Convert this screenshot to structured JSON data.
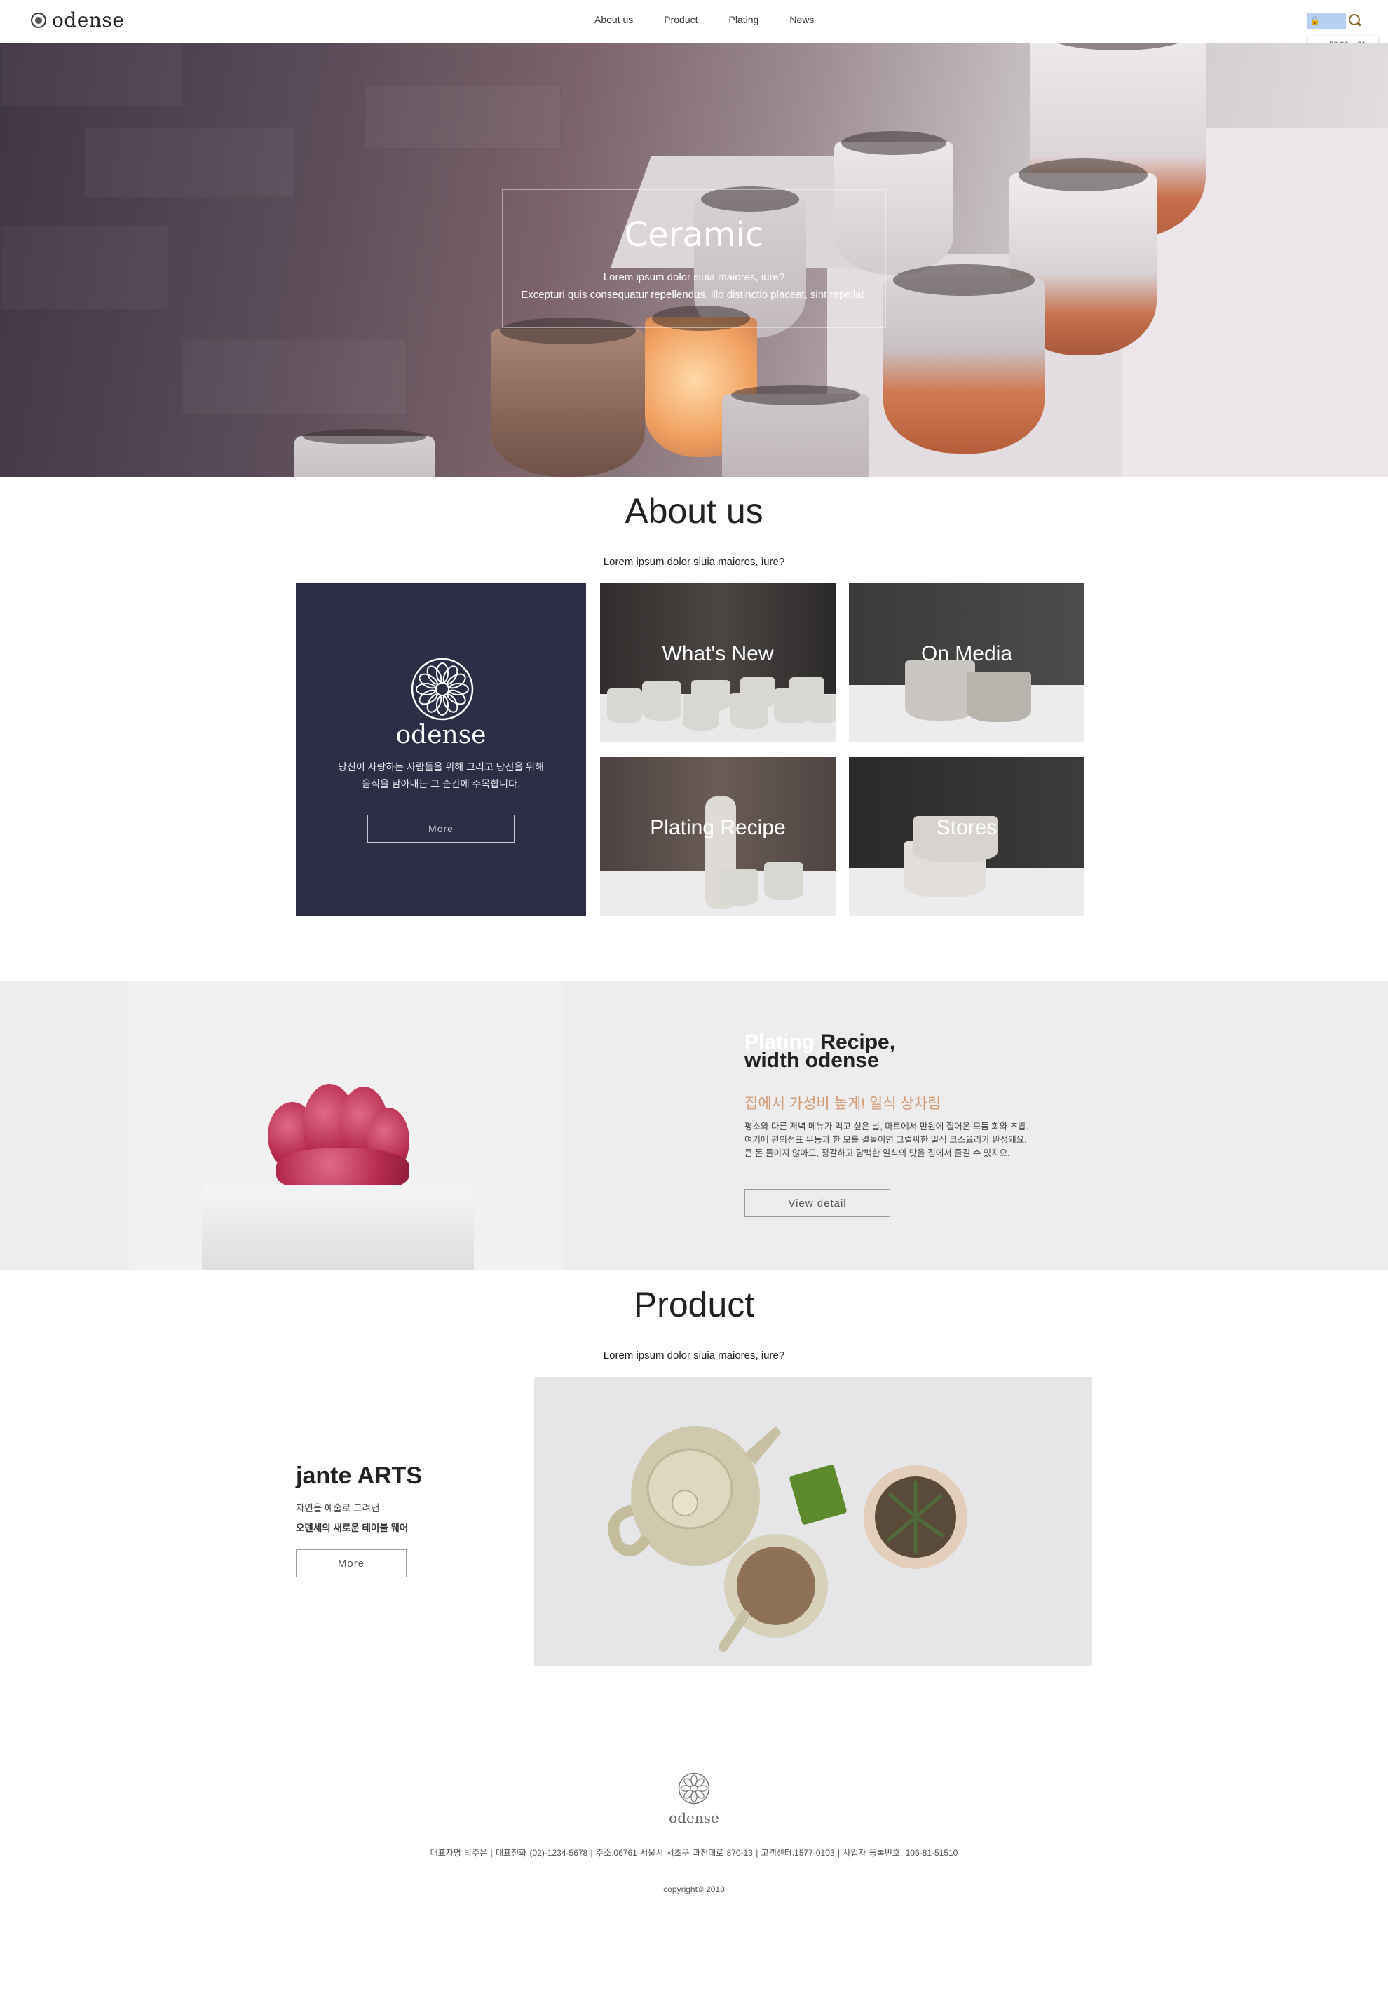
{
  "header": {
    "logo": "odense",
    "nav": [
      "About us",
      "Product",
      "Plating",
      "News"
    ],
    "tooltip_tag": "a",
    "tooltip_size": "52.86 × 21",
    "colors": {
      "search_highlight": "#b7cff0",
      "search_icon": "#8a6a2c"
    }
  },
  "hero": {
    "title": "Ceramic",
    "line1": "Lorem ipsum dolor siuia maiores, iure?",
    "line2": "Excepturi quis consequatur repellendus, illo distinctio placeat, sint repellat."
  },
  "about": {
    "title": "About us",
    "subtitle": "Lorem ipsum dolor siuia maiores, iure?",
    "brand_card": {
      "name": "odense",
      "desc_line1": "당신이 사랑하는 사람들을 위해 그리고 당신을 위해",
      "desc_line2": "음식을 담아내는 그 순간에 주목합니다.",
      "button": "More",
      "color": "#2b2e45"
    },
    "tiles": [
      "What's New",
      "On Media",
      "Plating Recipe",
      "Stores"
    ]
  },
  "plating": {
    "title_ghost": "Plating",
    "title_rest": " Recipe,",
    "title_line2": "width odense",
    "subtitle": "집에서 가성비 높게! 일식 상차림",
    "desc_line1": "평소와 다른 저녁 메뉴가 먹고 싶은 날, 마트에서 만원에 집어온 모둠 회와 초밥.",
    "desc_line2": "여기에 편의점표 우동과 한 모를 곁들이면 그럴싸한 일식 코스요리가 완성돼요.",
    "desc_line3": "큰 돈 들이지 않아도, 정갈하고 담백한 일식의 맛을 집에서 즐길 수 있지요.",
    "button": "View detail",
    "accent": "#d29a74"
  },
  "product": {
    "title": "Product",
    "subtitle": "Lorem ipsum dolor siuia maiores, iure?",
    "name": "jante ARTS",
    "desc1": "자연을 예술로 그려낸",
    "desc2": "오덴세의 새로운 테이블 웨어",
    "button": "More"
  },
  "footer": {
    "logo": "odense",
    "info": "대표자명 박주은 |   대표전화 (02)-1234-5678 |   주소.06761 서울시 서초구 과천대로 870-13 |   고객센터.1577-0103 |   사업자 등록번호. 106-81-51510",
    "copyright": "copyright© 2018"
  }
}
